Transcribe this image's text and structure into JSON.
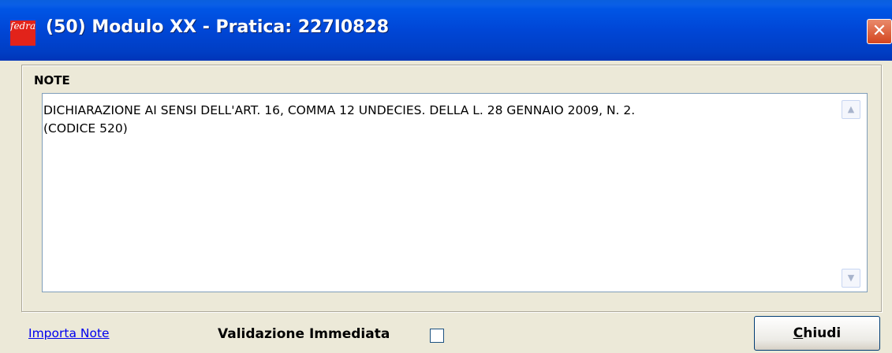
{
  "window": {
    "title": "(50) Modulo XX - Pratica: 227I0828",
    "close_glyph": "✕",
    "icon_text": "fedra"
  },
  "notes": {
    "label": "NOTE",
    "content": "DICHIARAZIONE AI SENSI DELL'ART. 16, COMMA 12 UNDECIES. DELLA L. 28 GENNAIO 2009, N. 2.\n(CODICE 520)"
  },
  "footer": {
    "import_link": "Importa Note",
    "validation_label": "Validazione Immediata",
    "validation_checked": false,
    "close_button_accel": "C",
    "close_button_rest": "hiudi"
  }
}
